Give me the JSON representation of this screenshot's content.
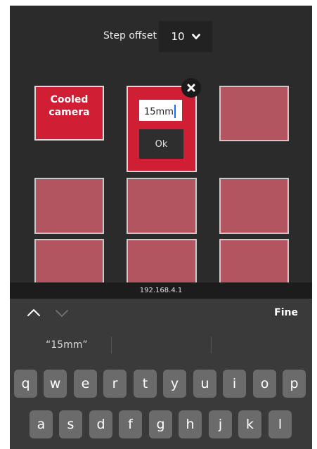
{
  "step_offset": {
    "label": "Step offset",
    "value": "10"
  },
  "cells": [
    {
      "label": "Cooled camera"
    },
    {
      "input_value": "15mm",
      "ok_label": "Ok"
    }
  ],
  "ip_address": "192.168.4.1",
  "accessory": {
    "done_label": "Fine"
  },
  "suggestion": "“15mm”",
  "keyboard": {
    "row1": [
      "q",
      "w",
      "e",
      "r",
      "t",
      "y",
      "u",
      "i",
      "o",
      "p"
    ],
    "row2": [
      "a",
      "s",
      "d",
      "f",
      "g",
      "h",
      "j",
      "k",
      "l"
    ]
  },
  "colors": {
    "cell_inactive": "#b25560",
    "cell_active": "#d01f35",
    "background": "#2b2b2b"
  }
}
